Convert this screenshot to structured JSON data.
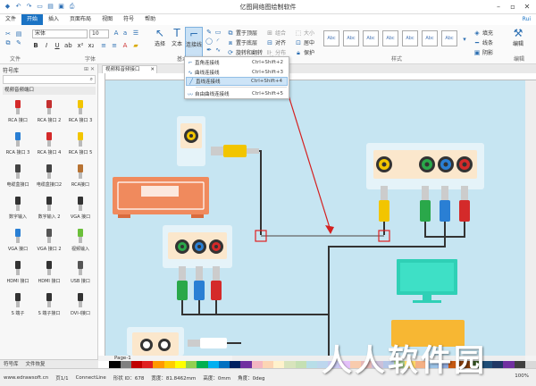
{
  "app": {
    "title": "亿图网络图绘制软件"
  },
  "menu": {
    "items": [
      "文件",
      "开始",
      "插入",
      "页面布局",
      "视图",
      "符号",
      "帮助"
    ],
    "active": "开始",
    "user": "Rui"
  },
  "ribbon": {
    "font_name": "宋体",
    "font_size": "10",
    "group_labels": {
      "file": "文件",
      "font": "字体",
      "basic_tools": "基本工具",
      "arrange": "排列",
      "style": "样式",
      "edit": "编辑"
    },
    "tools": {
      "select": "选择",
      "text": "文本",
      "connector": "连接线"
    },
    "arrange": {
      "bring_front": "置于顶层",
      "send_back": "置于底层",
      "rotate": "旋转和翻转",
      "group": "组合",
      "align": "对齐",
      "distribute": "分布",
      "size": "大小",
      "center": "居中",
      "protect": "保护"
    },
    "style_swatch": "Abc",
    "right": {
      "fill": "填充",
      "line": "线条",
      "shadow": "阴影",
      "edit_label": "编辑"
    }
  },
  "connector_menu": {
    "items": [
      {
        "label": "直角连接线",
        "shortcut": "Ctrl+Shift+2",
        "highlighted": false
      },
      {
        "label": "曲线连接线",
        "shortcut": "Ctrl+Shift+3",
        "highlighted": false
      },
      {
        "label": "直线连接线",
        "shortcut": "Ctrl+Shift+4",
        "highlighted": true
      },
      {
        "label": "自由曲线连接线",
        "shortcut": "Ctrl+Shift+5",
        "highlighted": false
      }
    ]
  },
  "library": {
    "title": "符号库",
    "category": "视频音频端口",
    "symbols": [
      "RCA 接口",
      "RCA 接口 2",
      "RCA 接口 3",
      "RCA 接口 3",
      "RCA 接口 4",
      "RCA 接口 5",
      "电缆盒接口",
      "电缆盒接口2",
      "RCA接口",
      "数字输入",
      "数字输入 2",
      "VGA 接口",
      "VGA 接口",
      "VGA 接口 2",
      "视频输入",
      "HDMI 接口",
      "HDMI 接口",
      "USB 接口",
      "S 端子",
      "S 端子接口",
      "DVI-I接口"
    ],
    "bottom_tabs": [
      "符号库",
      "文件恢复"
    ]
  },
  "document": {
    "tab": "视频和音频接口",
    "page_tab": "Page-1"
  },
  "status": {
    "url": "www.edrawsoft.cn",
    "page": "页1/1",
    "shape": "ConnectLine",
    "shape_id": "形状 ID：678",
    "width": "宽度：81.8462mm",
    "height": "高度：0mm",
    "angle": "角度：0deg",
    "zoom": "100%"
  },
  "watermark": "人人软件园",
  "colors": {
    "accent": "#1a73c4",
    "canvas": "#c6e5f2",
    "selection": "#e02020",
    "arrow": "#d42020"
  }
}
